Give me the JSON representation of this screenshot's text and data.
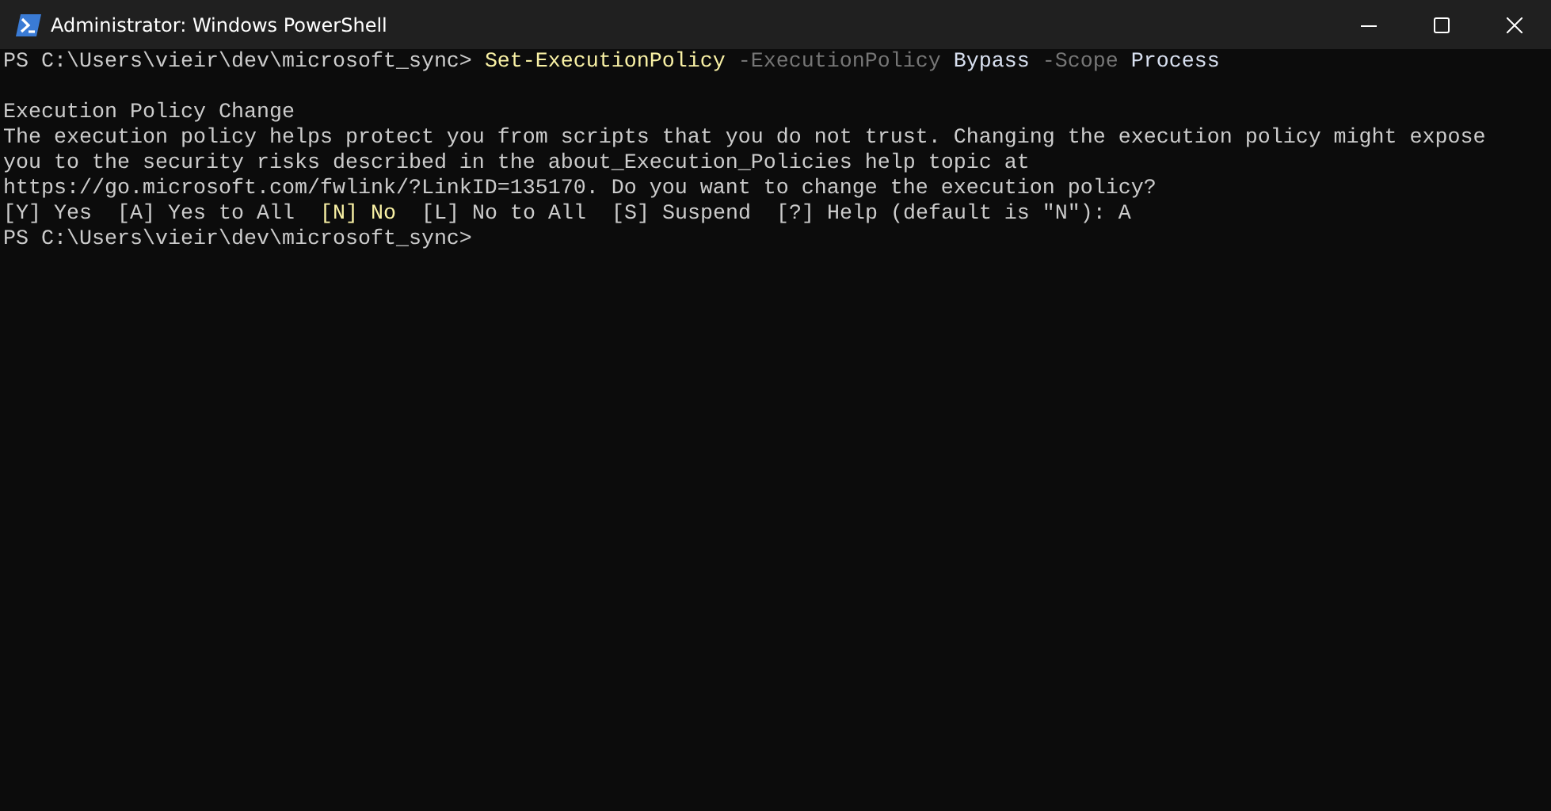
{
  "window": {
    "title": "Administrator: Windows PowerShell"
  },
  "console": {
    "lines": [
      {
        "kind": "command",
        "prompt": "PS C:\\Users\\vieir\\dev\\microsoft_sync>",
        "command": "Set-ExecutionPolicy",
        "parameters": [
          {
            "name": "-ExecutionPolicy",
            "value": "Bypass"
          },
          {
            "name": "-Scope",
            "value": "Process"
          }
        ]
      },
      {
        "kind": "blank"
      },
      {
        "kind": "text",
        "text": "Execution Policy Change"
      },
      {
        "kind": "text",
        "text": "The execution policy helps protect you from scripts that you do not trust. Changing the execution policy might expose"
      },
      {
        "kind": "text",
        "text": "you to the security risks described in the about_Execution_Policies help topic at"
      },
      {
        "kind": "text",
        "text": "https://go.microsoft.com/fwlink/?LinkID=135170. Do you want to change the execution policy?"
      },
      {
        "kind": "choice",
        "options": [
          {
            "label": "[Y] Yes",
            "default": false
          },
          {
            "label": "[A] Yes to All",
            "default": false
          },
          {
            "label": "[N] No",
            "default": true
          },
          {
            "label": "[L] No to All",
            "default": false
          },
          {
            "label": "[S] Suspend",
            "default": false
          },
          {
            "label": "[?] Help",
            "default": false
          }
        ],
        "answer": "(default is \"N\"): A"
      },
      {
        "kind": "prompt",
        "prompt": "PS C:\\Users\\vieir\\dev\\microsoft_sync>"
      }
    ]
  }
}
